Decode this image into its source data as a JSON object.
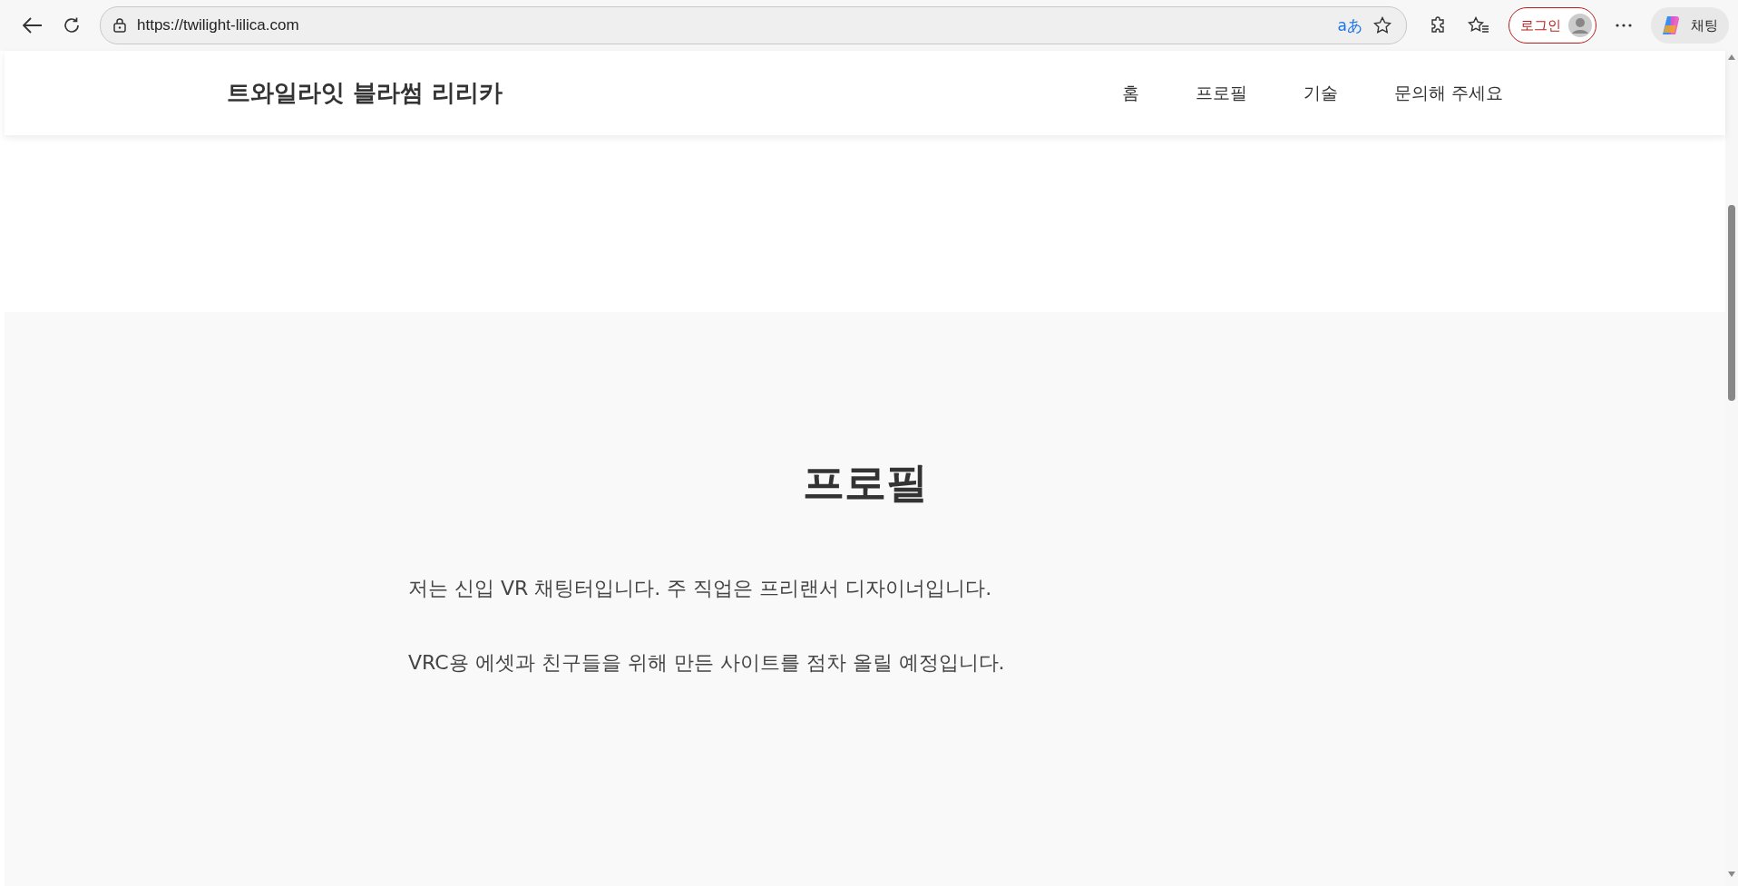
{
  "browser": {
    "url": "https://twilight-lilica.com",
    "login_label": "로그인",
    "chat_label": "채팅",
    "translate_label": "aあ"
  },
  "site": {
    "title": "트와일라잇 블라썸 리리카",
    "nav": [
      {
        "label": "홈"
      },
      {
        "label": "프로필"
      },
      {
        "label": "기술"
      },
      {
        "label": "문의해 주세요"
      }
    ]
  },
  "section": {
    "heading": "프로필",
    "paragraphs": [
      "저는 신입 VR 채팅터입니다. 주 직업은 프리랜서 디자이너입니다.",
      "VRC용 에셋과 친구들을 위해 만든 사이트를 점차 올릴 예정입니다."
    ]
  }
}
